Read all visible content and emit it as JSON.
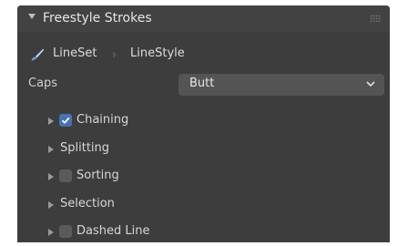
{
  "panel": {
    "title": "Freestyle Strokes"
  },
  "breadcrumb": {
    "lineset": "LineSet",
    "linestyle": "LineStyle"
  },
  "caps": {
    "label": "Caps",
    "value": "Butt"
  },
  "subpanels": [
    {
      "label": "Chaining",
      "checkbox": true,
      "checked": true
    },
    {
      "label": "Splitting",
      "checkbox": false
    },
    {
      "label": "Sorting",
      "checkbox": true,
      "checked": false
    },
    {
      "label": "Selection",
      "checkbox": false
    },
    {
      "label": "Dashed Line",
      "checkbox": true,
      "checked": false
    }
  ],
  "colors": {
    "panel_bg": "#3d3d3d",
    "header_bg": "#424242",
    "dropdown_bg": "#545454",
    "accent_checkbox": "#4772b3",
    "brush_icon": "#6e9fe0"
  }
}
